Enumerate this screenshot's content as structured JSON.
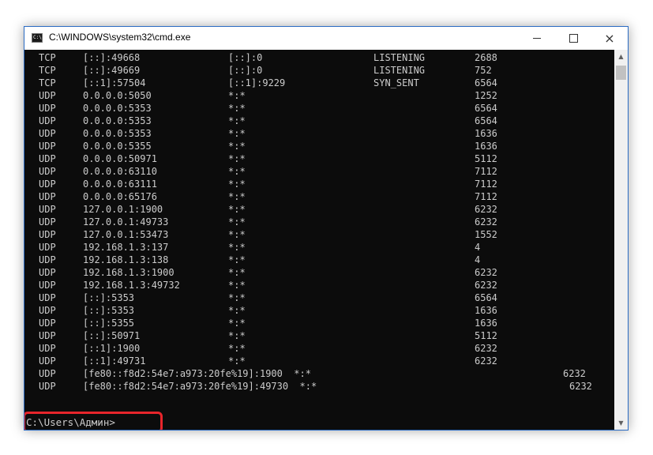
{
  "window": {
    "title": "C:\\WINDOWS\\system32\\cmd.exe",
    "icon_label": "C:\\",
    "controls": {
      "minimize": "minimize-icon",
      "maximize": "maximize-icon",
      "close": "×"
    }
  },
  "console": {
    "rows": [
      {
        "proto": "TCP",
        "local": "[::]:49668",
        "foreign": "[::]:0",
        "state": "LISTENING",
        "pid": "2688"
      },
      {
        "proto": "TCP",
        "local": "[::]:49669",
        "foreign": "[::]:0",
        "state": "LISTENING",
        "pid": "752"
      },
      {
        "proto": "TCP",
        "local": "[::1]:57504",
        "foreign": "[::1]:9229",
        "state": "SYN_SENT",
        "pid": "6564"
      },
      {
        "proto": "UDP",
        "local": "0.0.0.0:5050",
        "foreign": "*:*",
        "state": "",
        "pid": "1252"
      },
      {
        "proto": "UDP",
        "local": "0.0.0.0:5353",
        "foreign": "*:*",
        "state": "",
        "pid": "6564"
      },
      {
        "proto": "UDP",
        "local": "0.0.0.0:5353",
        "foreign": "*:*",
        "state": "",
        "pid": "6564"
      },
      {
        "proto": "UDP",
        "local": "0.0.0.0:5353",
        "foreign": "*:*",
        "state": "",
        "pid": "1636"
      },
      {
        "proto": "UDP",
        "local": "0.0.0.0:5355",
        "foreign": "*:*",
        "state": "",
        "pid": "1636"
      },
      {
        "proto": "UDP",
        "local": "0.0.0.0:50971",
        "foreign": "*:*",
        "state": "",
        "pid": "5112"
      },
      {
        "proto": "UDP",
        "local": "0.0.0.0:63110",
        "foreign": "*:*",
        "state": "",
        "pid": "7112"
      },
      {
        "proto": "UDP",
        "local": "0.0.0.0:63111",
        "foreign": "*:*",
        "state": "",
        "pid": "7112"
      },
      {
        "proto": "UDP",
        "local": "0.0.0.0:65176",
        "foreign": "*:*",
        "state": "",
        "pid": "7112"
      },
      {
        "proto": "UDP",
        "local": "127.0.0.1:1900",
        "foreign": "*:*",
        "state": "",
        "pid": "6232"
      },
      {
        "proto": "UDP",
        "local": "127.0.0.1:49733",
        "foreign": "*:*",
        "state": "",
        "pid": "6232"
      },
      {
        "proto": "UDP",
        "local": "127.0.0.1:53473",
        "foreign": "*:*",
        "state": "",
        "pid": "1552"
      },
      {
        "proto": "UDP",
        "local": "192.168.1.3:137",
        "foreign": "*:*",
        "state": "",
        "pid": "4"
      },
      {
        "proto": "UDP",
        "local": "192.168.1.3:138",
        "foreign": "*:*",
        "state": "",
        "pid": "4"
      },
      {
        "proto": "UDP",
        "local": "192.168.1.3:1900",
        "foreign": "*:*",
        "state": "",
        "pid": "6232"
      },
      {
        "proto": "UDP",
        "local": "192.168.1.3:49732",
        "foreign": "*:*",
        "state": "",
        "pid": "6232"
      },
      {
        "proto": "UDP",
        "local": "[::]:5353",
        "foreign": "*:*",
        "state": "",
        "pid": "6564"
      },
      {
        "proto": "UDP",
        "local": "[::]:5353",
        "foreign": "*:*",
        "state": "",
        "pid": "1636"
      },
      {
        "proto": "UDP",
        "local": "[::]:5355",
        "foreign": "*:*",
        "state": "",
        "pid": "1636"
      },
      {
        "proto": "UDP",
        "local": "[::]:50971",
        "foreign": "*:*",
        "state": "",
        "pid": "5112"
      },
      {
        "proto": "UDP",
        "local": "[::1]:1900",
        "foreign": "*:*",
        "state": "",
        "pid": "6232"
      },
      {
        "proto": "UDP",
        "local": "[::1]:49731",
        "foreign": "*:*",
        "state": "",
        "pid": "6232"
      }
    ],
    "long_rows": [
      {
        "proto": "UDP",
        "text": "[fe80::f8d2:54e7:a973:20fe%19]:1900  *:*",
        "pid": "6232"
      },
      {
        "proto": "UDP",
        "text": "[fe80::f8d2:54e7:a973:20fe%19]:49730  *:*",
        "pid": "6232"
      }
    ],
    "prompt": "C:\\Users\\Админ>"
  },
  "scrollbar": {
    "up": "▲",
    "down": "▼"
  },
  "colors": {
    "console_background": "#0c0c0c",
    "console_text": "#cccccc",
    "highlight_border": "#e8252b",
    "window_border": "#2b6cc4"
  }
}
